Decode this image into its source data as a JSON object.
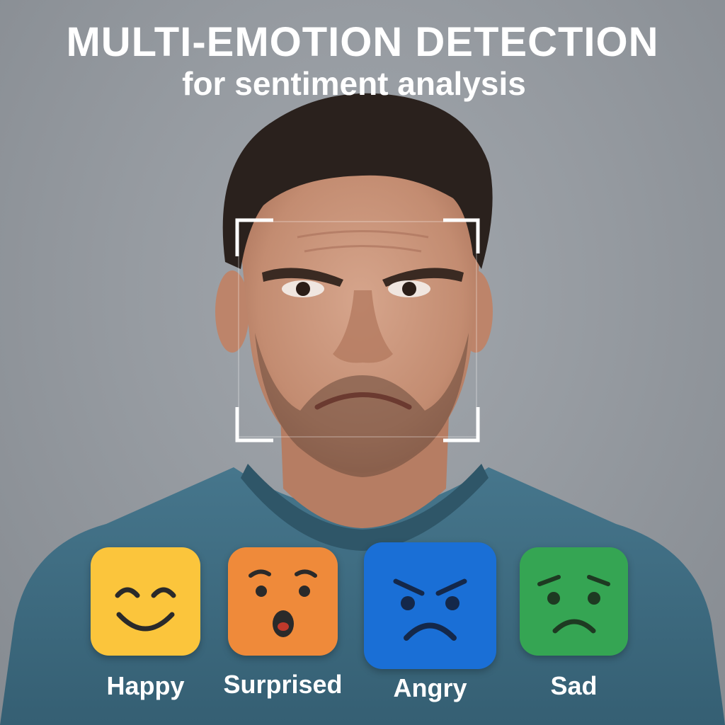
{
  "header": {
    "title": "MULTI-EMOTION DETECTION",
    "subtitle": "for sentiment analysis"
  },
  "portrait": {
    "icon": "frowning-man-portrait",
    "detection_frame": "face-detection-frame"
  },
  "emotions": [
    {
      "label": "Happy",
      "icon": "happy-face-icon",
      "color": "#fbc53c"
    },
    {
      "label": "Surprised",
      "icon": "surprised-face-icon",
      "color": "#ef8a3a"
    },
    {
      "label": "Angry",
      "icon": "angry-face-icon",
      "color": "#1a6fd6"
    },
    {
      "label": "Sad",
      "icon": "sad-face-icon",
      "color": "#35a553"
    }
  ],
  "colors": {
    "background": "#969ba1",
    "shirt": "#3f6f85",
    "text": "#ffffff"
  }
}
